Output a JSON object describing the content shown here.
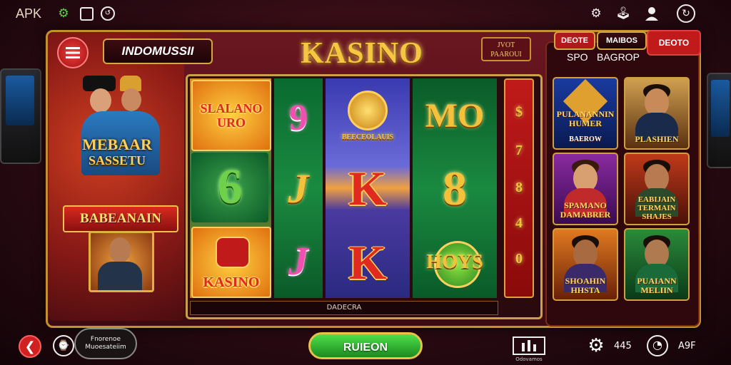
{
  "topbar": {
    "apk_label": "APK",
    "icons": [
      "gear-icon",
      "save-icon",
      "history-icon",
      "settings-icon",
      "joystick-icon",
      "user-icon",
      "refresh-icon"
    ]
  },
  "left_panel": {
    "menu_label": "INDOMUSSII",
    "promo_title_line1": "MEBAAR",
    "promo_title_line2": "SASSETU",
    "banner_label": "BABEANAIN"
  },
  "header": {
    "title": "KASINO",
    "top_right_badge": "JVOT\nPAAROUI"
  },
  "reels": {
    "col1": [
      "SLALANO\nURO",
      "6",
      "KASINO"
    ],
    "col2": [
      "9",
      "J",
      "J"
    ],
    "col3": [
      "BEECEOLAUIS",
      "K",
      "K"
    ],
    "col4": [
      "MO",
      "8",
      "HOYS"
    ],
    "side": [
      "$",
      "7",
      "8",
      "4",
      "0"
    ],
    "footer_label": "DADECRA"
  },
  "right_panel": {
    "tab1": "DEOTE",
    "tab2": "MAIBOS",
    "tab3": "DEOTO",
    "sub1": "SPO",
    "sub2": "BAGROP",
    "cards": [
      {
        "label": "PULANANNIN\nHUMER",
        "sub": "BAEROW"
      },
      {
        "label": "PLASHIEN",
        "sub": ""
      },
      {
        "label": "SPAMANO\nDAMABRER",
        "sub": ""
      },
      {
        "label": "EABIJAIN\nTERMAIN\nSHAJES",
        "sub": ""
      },
      {
        "label": "SHOAHIN\nHHSTA",
        "sub": ""
      },
      {
        "label": "PUAIANN\nMELIIN",
        "sub": ""
      }
    ]
  },
  "bottombar": {
    "info_label": "Fnorenoe\nMuoesateiim",
    "spin_label": "RUIEON",
    "stats_label": "Odovamos",
    "value1": "445",
    "value2": "A9F"
  },
  "colors": {
    "gold": "#f4c23a",
    "frame": "#c8902c",
    "spin_green": "#2fb22a",
    "maroon": "#5a1420"
  }
}
